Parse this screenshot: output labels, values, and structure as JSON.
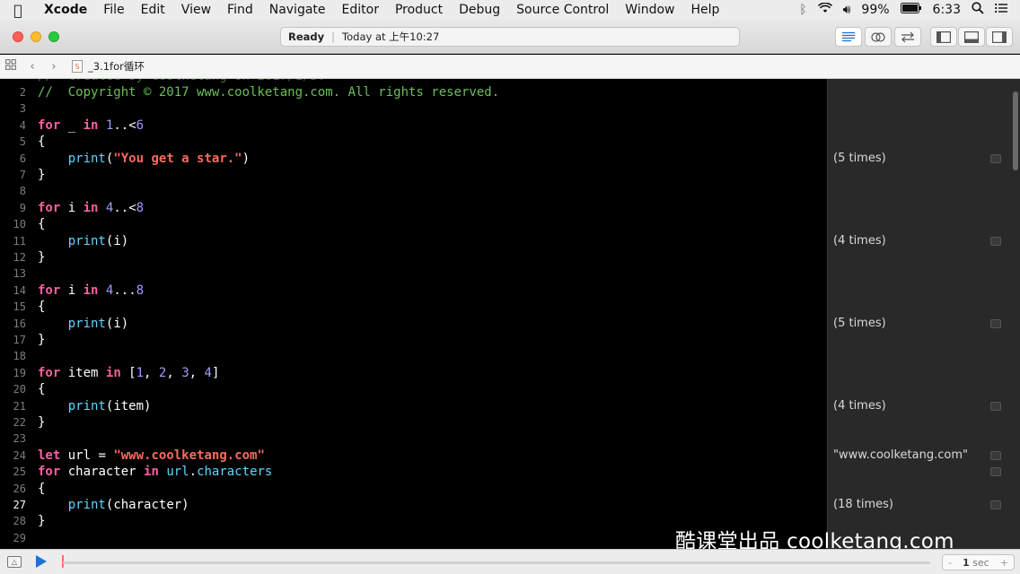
{
  "menubar": {
    "apple": "",
    "items": [
      "Xcode",
      "File",
      "Edit",
      "View",
      "Find",
      "Navigate",
      "Editor",
      "Product",
      "Debug",
      "Source Control",
      "Window",
      "Help"
    ],
    "battery": "99%",
    "time": "6:33"
  },
  "toolbar": {
    "status": "Ready",
    "activity": "Today at 上午10:27"
  },
  "jumpbar": {
    "filename": "_3.1for循环"
  },
  "editor": {
    "lines": [
      {
        "n": "2",
        "code": "//  Copyright © 2017 www.coolketang.com. All rights reserved."
      },
      {
        "n": "3",
        "code": ""
      },
      {
        "n": "4",
        "code": "for _ in 1..<6"
      },
      {
        "n": "5",
        "code": "{"
      },
      {
        "n": "6",
        "code": "    print(\"You get a star.\")"
      },
      {
        "n": "7",
        "code": "}"
      },
      {
        "n": "8",
        "code": ""
      },
      {
        "n": "9",
        "code": "for i in 4..<8"
      },
      {
        "n": "10",
        "code": "{"
      },
      {
        "n": "11",
        "code": "    print(i)"
      },
      {
        "n": "12",
        "code": "}"
      },
      {
        "n": "13",
        "code": ""
      },
      {
        "n": "14",
        "code": "for i in 4...8"
      },
      {
        "n": "15",
        "code": "{"
      },
      {
        "n": "16",
        "code": "    print(i)"
      },
      {
        "n": "17",
        "code": "}"
      },
      {
        "n": "18",
        "code": ""
      },
      {
        "n": "19",
        "code": "for item in [1, 2, 3, 4]"
      },
      {
        "n": "20",
        "code": "{"
      },
      {
        "n": "21",
        "code": "    print(item)"
      },
      {
        "n": "22",
        "code": "}"
      },
      {
        "n": "23",
        "code": ""
      },
      {
        "n": "24",
        "code": "let url = \"www.coolketang.com\""
      },
      {
        "n": "25",
        "code": "for character in url.characters"
      },
      {
        "n": "26",
        "code": "{"
      },
      {
        "n": "27",
        "code": "    print(character)"
      },
      {
        "n": "28",
        "code": "}"
      },
      {
        "n": "29",
        "code": ""
      }
    ],
    "current_line": "27"
  },
  "results": [
    {
      "line": "6",
      "text": "(5 times)"
    },
    {
      "line": "11",
      "text": "(4 times)"
    },
    {
      "line": "16",
      "text": "(5 times)"
    },
    {
      "line": "21",
      "text": "(4 times)"
    },
    {
      "line": "24",
      "text": "\"www.coolketang.com\""
    },
    {
      "line": "25",
      "text": ""
    },
    {
      "line": "27",
      "text": "(18 times)"
    }
  ],
  "watermark": "酷课堂出品 coolketang.com",
  "bottombar": {
    "stepper_minus": "-",
    "stepper_value": "1",
    "stepper_unit": "sec",
    "stepper_plus": "+"
  }
}
